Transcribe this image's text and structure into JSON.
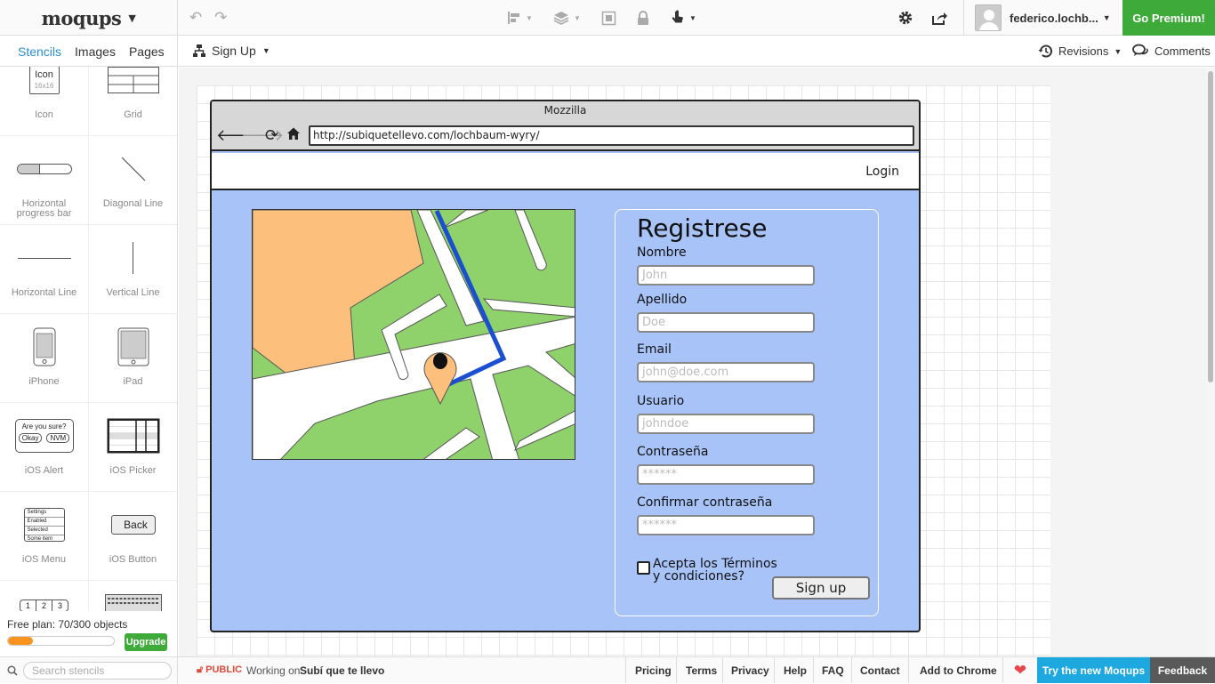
{
  "app": {
    "logo": "moqups",
    "upgrade_cta": "Go Premium!",
    "user_name": "federico.lochb...",
    "colors": {
      "accent_green": "#3eaa3a",
      "link_blue": "#2a8fd0",
      "canvas_blue": "#a8c3f8",
      "progress_orange": "#f7941d",
      "try_blue": "#1ea8e0"
    }
  },
  "toolbar": {
    "icons": [
      "undo-icon",
      "redo-icon",
      "align-icon",
      "layers-icon",
      "group-icon",
      "lock-icon",
      "interaction-icon",
      "settings-icon",
      "share-icon"
    ]
  },
  "sidebar": {
    "tabs": [
      "Stencils",
      "Images",
      "Pages"
    ],
    "stencils": [
      {
        "label": "Icon",
        "icon_text": "Icon",
        "icon_sub": "16x16"
      },
      {
        "label": "Grid"
      },
      {
        "label": "Horizontal progress bar"
      },
      {
        "label": "Diagonal Line"
      },
      {
        "label": "Horizontal Line"
      },
      {
        "label": "Vertical Line"
      },
      {
        "label": "iPhone"
      },
      {
        "label": "iPad"
      },
      {
        "label": "iOS Alert",
        "alert_title": "Are you sure?",
        "alert_ok": "Okay",
        "alert_no": "NVM"
      },
      {
        "label": "iOS Picker"
      },
      {
        "label": "iOS Menu",
        "menu_items": [
          "Settings",
          "Enabled",
          "Selected",
          "Some item"
        ]
      },
      {
        "label": "iOS Button",
        "button_text": "Back"
      },
      {
        "label": "",
        "numbers": [
          "1",
          "2",
          "3"
        ]
      }
    ],
    "plan_text": "Free plan: 70/300 objects",
    "plan_progress": 0.233,
    "upgrade_label": "Upgrade",
    "search_placeholder": "Search stencils"
  },
  "header": {
    "page_name": "Sign Up",
    "revisions": "Revisions",
    "comments": "Comments"
  },
  "mockup": {
    "browser_title": "Mozzilla",
    "url": "http://subiquetellevo.com/lochbaum-wyry/",
    "nav_login": "Login",
    "form_title": "Registrese",
    "fields": [
      {
        "label": "Nombre",
        "placeholder": "John"
      },
      {
        "label": "Apellido",
        "placeholder": "Doe"
      },
      {
        "label": "Email",
        "placeholder": "john@doe.com"
      },
      {
        "label": "Usuario",
        "placeholder": "johndoe"
      },
      {
        "label": "Contraseña",
        "placeholder": "******"
      },
      {
        "label": "Confirmar contraseña",
        "placeholder": "******"
      }
    ],
    "terms_line1": "Acepta los Términos",
    "terms_line2": "y condiciones?",
    "signup_button": "Sign up"
  },
  "footer": {
    "visibility": "PUBLIC",
    "working_on": "Working on",
    "project_name": "Subí que te llevo",
    "links": [
      "Pricing",
      "Terms",
      "Privacy",
      "Help",
      "FAQ",
      "Contact",
      "Add to Chrome"
    ],
    "try_new": "Try the new Moqups",
    "feedback": "Feedback"
  }
}
